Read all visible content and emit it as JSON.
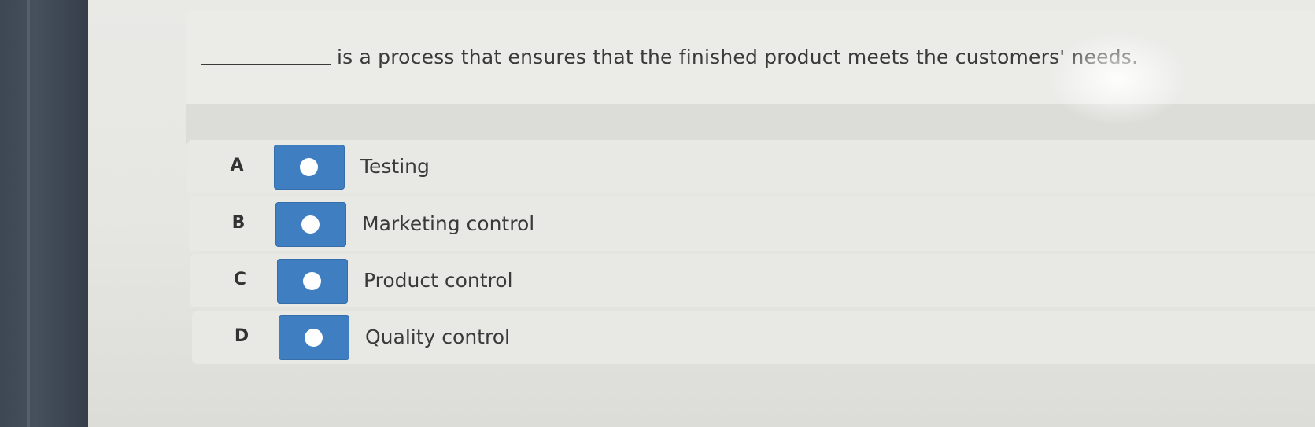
{
  "question": {
    "blank": "",
    "text": "is a process that ensures that the finished product meets the customers' needs."
  },
  "options": [
    {
      "letter": "A",
      "label": "Testing",
      "selected": false
    },
    {
      "letter": "B",
      "label": "Marketing control",
      "selected": false
    },
    {
      "letter": "C",
      "label": "Product control",
      "selected": false
    },
    {
      "letter": "D",
      "label": "Quality control",
      "selected": false
    }
  ],
  "colors": {
    "radio_button": "#3f7fc1",
    "radio_dot": "#ffffff",
    "text": "#3a3a3a"
  }
}
